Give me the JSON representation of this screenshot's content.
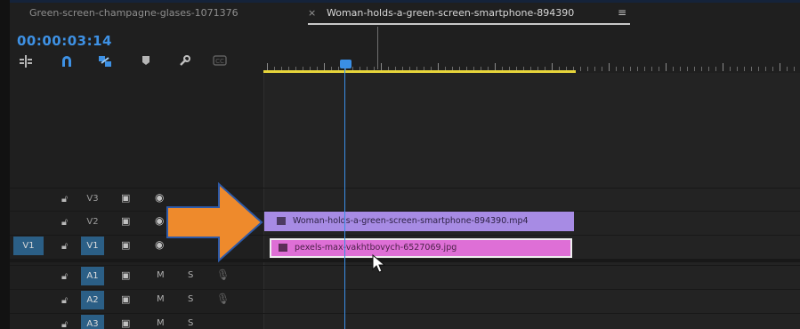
{
  "tabs": [
    {
      "label": "Green-screen-champagne-glases-1071376"
    },
    {
      "label": "Woman-holds-a-green-screen-smartphone-894390",
      "close": "×",
      "menu": "≡"
    }
  ],
  "timecode": "00:00:03:14",
  "toolbar_icons": [
    "insert-snap-icon",
    "magnet-icon",
    "linked-selection-icon",
    "marker-icon",
    "wrench-icon",
    "captions-icon"
  ],
  "tracks": {
    "v3": {
      "name": "V3"
    },
    "v2": {
      "name": "V2"
    },
    "v1": {
      "name": "V1",
      "source": "V1"
    },
    "a1": {
      "name": "A1",
      "mute": "M",
      "solo": "S"
    },
    "a2": {
      "name": "A2",
      "mute": "M",
      "solo": "S"
    },
    "a3": {
      "name": "A3",
      "mute": "M",
      "solo": "S"
    }
  },
  "clips": {
    "v2_clip": "Woman-holds-a-green-screen-smartphone-894390.mp4",
    "v1_clip": "pexels-max-vakhtbovych-6527069.jpg"
  },
  "colors": {
    "accent": "#3e91e4",
    "inout_bar": "#e7d53b",
    "video_clip": "#a78be4",
    "image_clip": "#de6fd6",
    "track_target": "#2b5f86",
    "arrow": "#ee8a2c"
  }
}
